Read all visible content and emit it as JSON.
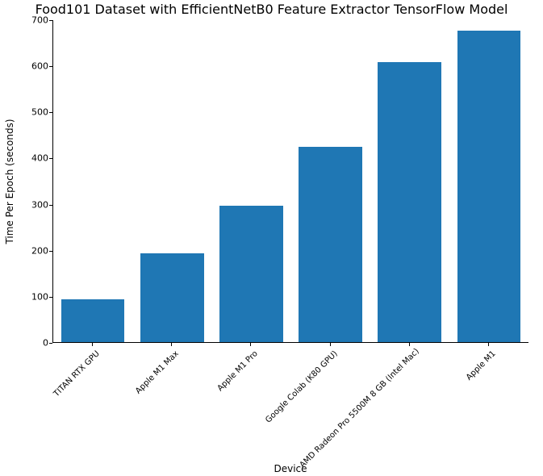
{
  "chart_data": {
    "type": "bar",
    "title": "Food101 Dataset with EfficientNetB0 Feature Extractor TensorFlow Model",
    "xlabel": "Device",
    "ylabel": "Time Per Epoch (seconds)",
    "ylim": [
      0,
      700
    ],
    "yticks": [
      0,
      100,
      200,
      300,
      400,
      500,
      600,
      700
    ],
    "categories": [
      "TITAN RTX GPU",
      "Apple M1 Max",
      "Apple M1 Pro",
      "Google Colab (K80 GPU)",
      "AMD Radeon Pro 5500M 8 GB (Intel Mac)",
      "Apple M1"
    ],
    "values": [
      93,
      193,
      296,
      424,
      608,
      676
    ],
    "bar_color": "#1f77b4"
  }
}
